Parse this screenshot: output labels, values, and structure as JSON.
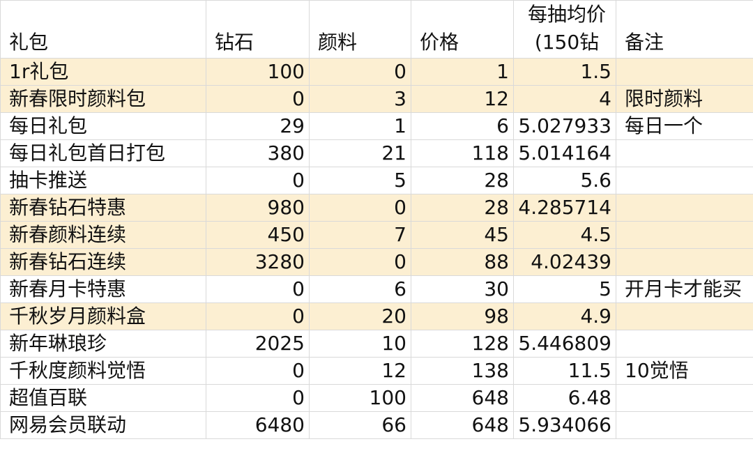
{
  "headers": {
    "package": "礼包",
    "diamonds": "钻石",
    "pigment": "颜料",
    "price": "价格",
    "per_draw_line1": "每抽均价",
    "per_draw_line2": "(150钻",
    "notes": "备注"
  },
  "highlight_color": "#fcefd2",
  "rows": [
    {
      "name": "1r礼包",
      "diamonds": "100",
      "pigment": "0",
      "price": "1",
      "per_draw": "1.5",
      "note": "",
      "highlight": true
    },
    {
      "name": "新春限时颜料包",
      "diamonds": "0",
      "pigment": "3",
      "price": "12",
      "per_draw": "4",
      "note": "限时颜料",
      "highlight": true
    },
    {
      "name": "每日礼包",
      "diamonds": "29",
      "pigment": "1",
      "price": "6",
      "per_draw": "5.027933",
      "note": "每日一个",
      "highlight": false
    },
    {
      "name": "每日礼包首日打包",
      "diamonds": "380",
      "pigment": "21",
      "price": "118",
      "per_draw": "5.014164",
      "note": "",
      "highlight": false
    },
    {
      "name": "抽卡推送",
      "diamonds": "0",
      "pigment": "5",
      "price": "28",
      "per_draw": "5.6",
      "note": "",
      "highlight": false
    },
    {
      "name": "新春钻石特惠",
      "diamonds": "980",
      "pigment": "0",
      "price": "28",
      "per_draw": "4.285714",
      "note": "",
      "highlight": true
    },
    {
      "name": "新春颜料连续",
      "diamonds": "450",
      "pigment": "7",
      "price": "45",
      "per_draw": "4.5",
      "note": "",
      "highlight": true
    },
    {
      "name": "新春钻石连续",
      "diamonds": "3280",
      "pigment": "0",
      "price": "88",
      "per_draw": "4.02439",
      "note": "",
      "highlight": true
    },
    {
      "name": "新春月卡特惠",
      "diamonds": "0",
      "pigment": "6",
      "price": "30",
      "per_draw": "5",
      "note": "开月卡才能买",
      "highlight": false
    },
    {
      "name": "千秋岁月颜料盒",
      "diamonds": "0",
      "pigment": "20",
      "price": "98",
      "per_draw": "4.9",
      "note": "",
      "highlight": true
    },
    {
      "name": "新年琳琅珍",
      "diamonds": "2025",
      "pigment": "10",
      "price": "128",
      "per_draw": "5.446809",
      "note": "",
      "highlight": false
    },
    {
      "name": "千秋度颜料觉悟",
      "diamonds": "0",
      "pigment": "12",
      "price": "138",
      "per_draw": "11.5",
      "note": "10觉悟",
      "highlight": false
    },
    {
      "name": "超值百联",
      "diamonds": "0",
      "pigment": "100",
      "price": "648",
      "per_draw": "6.48",
      "note": "",
      "highlight": false
    },
    {
      "name": "网易会员联动",
      "diamonds": "6480",
      "pigment": "66",
      "price": "648",
      "per_draw": "5.934066",
      "note": "",
      "highlight": false
    }
  ]
}
